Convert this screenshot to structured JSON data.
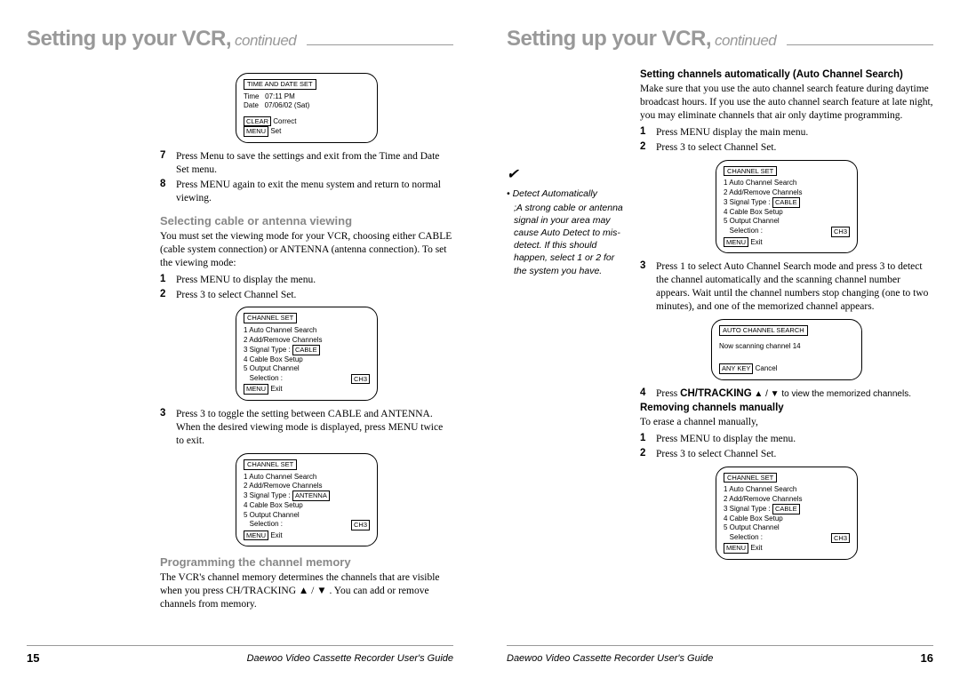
{
  "page_title_main": "Setting up your VCR,",
  "page_title_cont": "continued",
  "footer_title": "Daewoo Video Cassette Recorder User's Guide",
  "page_left_num": "15",
  "page_right_num": "16",
  "left": {
    "osd_time": {
      "title": "TIME AND DATE SET",
      "l1": "Time   07:11 PM",
      "l2": "Date   07/06/02 (Sat)",
      "clear": "CLEAR",
      "clear_t": " Correct",
      "menu": "MENU",
      "menu_t": " Set"
    },
    "s7": "Press Menu to save the settings and exit from the Time and Date Set menu.",
    "s8": "Press MENU again to exit the menu system and return to normal viewing.",
    "h_sel": "Selecting cable or antenna viewing",
    "p_sel": "You must set the viewing mode for your VCR, choosing either CABLE (cable system connection) or ANTENNA (antenna connection). To set the viewing mode:",
    "sel1": "Press MENU to display the menu.",
    "sel2": "Press 3 to select  Channel Set.",
    "osd_ch_cable": {
      "title": "CHANNEL SET",
      "l1": "1 Auto Channel Search",
      "l2": "2 Add/Remove Channels",
      "l3a": "3 Signal Type  : ",
      "l3b": "CABLE",
      "l4": "4 Cable Box Setup",
      "l5": "5 Output Channel",
      "l6a": "   Selection :",
      "l6b": "CH3",
      "menu": "MENU",
      "menu_t": " Exit"
    },
    "sel3": "Press 3 to toggle the setting between CABLE and ANTENNA. When the desired viewing mode is displayed, press MENU twice to exit.",
    "osd_ch_ant": {
      "title": "CHANNEL SET",
      "l1": "1 Auto Channel Search",
      "l2": "2 Add/Remove Channels",
      "l3a": "3 Signal Type  : ",
      "l3b": "ANTENNA",
      "l4": "4 Cable Box Setup",
      "l5": "5 Output Channel",
      "l6a": "   Selection :",
      "l6b": "CH3",
      "menu": "MENU",
      "menu_t": " Exit"
    },
    "h_prog": "Programming the channel memory",
    "p_prog": "The VCR's channel memory determines the channels that are visible when you press CH/TRACKING ▲ / ▼ . You can add or remove channels from memory."
  },
  "right": {
    "side_head": "Detect Automatically",
    "side_body": ";A strong cable or antenna signal in your area may cause Auto Detect to mis-detect. If this should happen, select 1 or 2 for the system you have.",
    "h_auto": "Setting channels automatically (Auto Channel Search)",
    "p_auto": "Make sure that you use the auto channel search feature during daytime broadcast hours. If you use the auto channel search feature at late night, you may eliminate channels that air only daytime programming.",
    "a1": "Press MENU display the main menu.",
    "a2": "Press 3 to select Channel Set.",
    "osd_ch": {
      "title": "CHANNEL SET",
      "l1": "1 Auto Channel Search",
      "l2": "2 Add/Remove Channels",
      "l3a": "3 Signal Type  : ",
      "l3b": "CABLE",
      "l4": "4 Cable Box Setup",
      "l5": "5 Output Channel",
      "l6a": "   Selection :",
      "l6b": "CH3",
      "menu": "MENU",
      "menu_t": " Exit"
    },
    "a3": "Press 1 to select Auto Channel Search mode and press 3 to detect the channel automatically and the scanning channel number appears. Wait until the channel numbers stop changing (one to two minutes), and one of the memorized channel appears.",
    "osd_scan": {
      "title": "AUTO CHANNEL SEARCH",
      "l1": "Now scanning channel 14",
      "any": "ANY KEY",
      "any_t": " Cancel"
    },
    "a4a": "Press ",
    "a4b": "CH/TRACKING",
    "a4c": " ▲ / ▼ to view the memorized channels.",
    "h_rem": "Removing channels manually",
    "p_rem": "To erase a channel manually,",
    "r1": "Press MENU to display the menu.",
    "r2": "Press 3 to select Channel Set.",
    "osd_ch2": {
      "title": "CHANNEL SET",
      "l1": "1 Auto Channel Search",
      "l2": "2 Add/Remove Channels",
      "l3a": "3 Signal Type  : ",
      "l3b": "CABLE",
      "l4": "4 Cable Box Setup",
      "l5": "5 Output Channel",
      "l6a": "   Selection :",
      "l6b": "CH3",
      "menu": "MENU",
      "menu_t": " Exit"
    }
  }
}
